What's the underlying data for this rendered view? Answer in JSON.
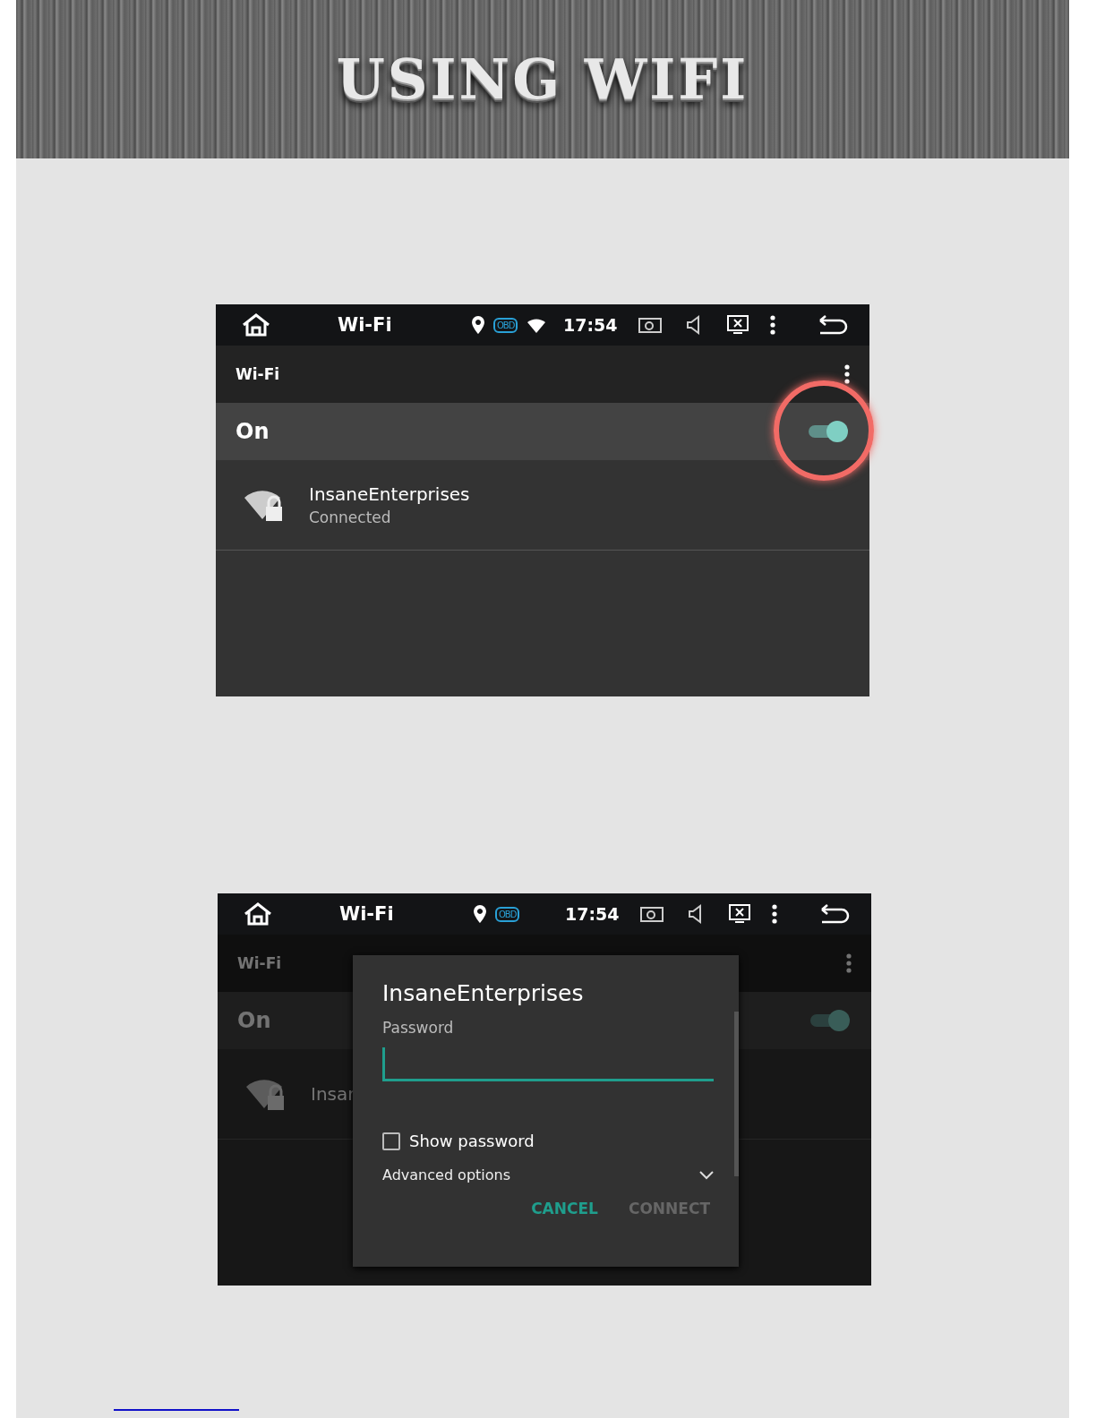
{
  "header": {
    "title": "USING WIFI"
  },
  "screens": [
    {
      "dimmed": false,
      "highlight_ring": true,
      "status_bar": {
        "title": "Wi-Fi",
        "time": "17:54",
        "icons": [
          {
            "kind": "location"
          },
          {
            "kind": "obd",
            "label": "OBD"
          },
          {
            "kind": "wifi"
          }
        ]
      },
      "toolbar": {
        "title": "Wi-Fi"
      },
      "master_switch": {
        "label": "On",
        "on": true
      },
      "networks": [
        {
          "name": "InsaneEnterprises",
          "status": "Connected"
        }
      ]
    },
    {
      "dimmed": true,
      "highlight_ring": false,
      "status_bar": {
        "title": "Wi-Fi",
        "time": "17:54",
        "icons": [
          {
            "kind": "location"
          },
          {
            "kind": "obd",
            "label": "OBD"
          }
        ]
      },
      "toolbar": {
        "title": "Wi-Fi"
      },
      "master_switch": {
        "label": "On",
        "on": true
      },
      "networks": [
        {
          "name": "Insar"
        }
      ],
      "dialog": {
        "title": "InsaneEnterprises",
        "password_label": "Password",
        "show_password": {
          "label": "Show password",
          "checked": false
        },
        "advanced": "Advanced options",
        "buttons": [
          {
            "label": "CANCEL",
            "disabled": false
          },
          {
            "label": "CONNECT",
            "disabled": true
          }
        ]
      }
    }
  ]
}
